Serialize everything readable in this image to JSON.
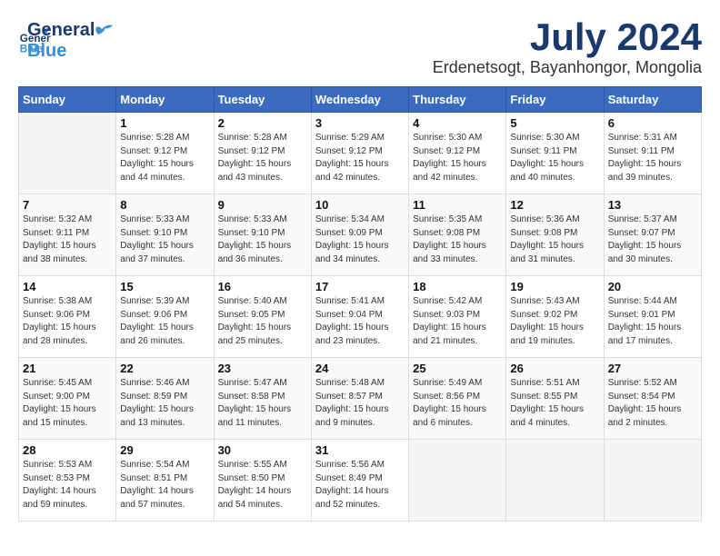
{
  "header": {
    "logo_general": "General",
    "logo_blue": "Blue",
    "month": "July 2024",
    "location": "Erdenetsogt, Bayanhongor, Mongolia"
  },
  "days_of_week": [
    "Sunday",
    "Monday",
    "Tuesday",
    "Wednesday",
    "Thursday",
    "Friday",
    "Saturday"
  ],
  "weeks": [
    [
      {
        "day": "",
        "info": ""
      },
      {
        "day": "1",
        "info": "Sunrise: 5:28 AM\nSunset: 9:12 PM\nDaylight: 15 hours\nand 44 minutes."
      },
      {
        "day": "2",
        "info": "Sunrise: 5:28 AM\nSunset: 9:12 PM\nDaylight: 15 hours\nand 43 minutes."
      },
      {
        "day": "3",
        "info": "Sunrise: 5:29 AM\nSunset: 9:12 PM\nDaylight: 15 hours\nand 42 minutes."
      },
      {
        "day": "4",
        "info": "Sunrise: 5:30 AM\nSunset: 9:12 PM\nDaylight: 15 hours\nand 42 minutes."
      },
      {
        "day": "5",
        "info": "Sunrise: 5:30 AM\nSunset: 9:11 PM\nDaylight: 15 hours\nand 40 minutes."
      },
      {
        "day": "6",
        "info": "Sunrise: 5:31 AM\nSunset: 9:11 PM\nDaylight: 15 hours\nand 39 minutes."
      }
    ],
    [
      {
        "day": "7",
        "info": "Sunrise: 5:32 AM\nSunset: 9:11 PM\nDaylight: 15 hours\nand 38 minutes."
      },
      {
        "day": "8",
        "info": "Sunrise: 5:33 AM\nSunset: 9:10 PM\nDaylight: 15 hours\nand 37 minutes."
      },
      {
        "day": "9",
        "info": "Sunrise: 5:33 AM\nSunset: 9:10 PM\nDaylight: 15 hours\nand 36 minutes."
      },
      {
        "day": "10",
        "info": "Sunrise: 5:34 AM\nSunset: 9:09 PM\nDaylight: 15 hours\nand 34 minutes."
      },
      {
        "day": "11",
        "info": "Sunrise: 5:35 AM\nSunset: 9:08 PM\nDaylight: 15 hours\nand 33 minutes."
      },
      {
        "day": "12",
        "info": "Sunrise: 5:36 AM\nSunset: 9:08 PM\nDaylight: 15 hours\nand 31 minutes."
      },
      {
        "day": "13",
        "info": "Sunrise: 5:37 AM\nSunset: 9:07 PM\nDaylight: 15 hours\nand 30 minutes."
      }
    ],
    [
      {
        "day": "14",
        "info": "Sunrise: 5:38 AM\nSunset: 9:06 PM\nDaylight: 15 hours\nand 28 minutes."
      },
      {
        "day": "15",
        "info": "Sunrise: 5:39 AM\nSunset: 9:06 PM\nDaylight: 15 hours\nand 26 minutes."
      },
      {
        "day": "16",
        "info": "Sunrise: 5:40 AM\nSunset: 9:05 PM\nDaylight: 15 hours\nand 25 minutes."
      },
      {
        "day": "17",
        "info": "Sunrise: 5:41 AM\nSunset: 9:04 PM\nDaylight: 15 hours\nand 23 minutes."
      },
      {
        "day": "18",
        "info": "Sunrise: 5:42 AM\nSunset: 9:03 PM\nDaylight: 15 hours\nand 21 minutes."
      },
      {
        "day": "19",
        "info": "Sunrise: 5:43 AM\nSunset: 9:02 PM\nDaylight: 15 hours\nand 19 minutes."
      },
      {
        "day": "20",
        "info": "Sunrise: 5:44 AM\nSunset: 9:01 PM\nDaylight: 15 hours\nand 17 minutes."
      }
    ],
    [
      {
        "day": "21",
        "info": "Sunrise: 5:45 AM\nSunset: 9:00 PM\nDaylight: 15 hours\nand 15 minutes."
      },
      {
        "day": "22",
        "info": "Sunrise: 5:46 AM\nSunset: 8:59 PM\nDaylight: 15 hours\nand 13 minutes."
      },
      {
        "day": "23",
        "info": "Sunrise: 5:47 AM\nSunset: 8:58 PM\nDaylight: 15 hours\nand 11 minutes."
      },
      {
        "day": "24",
        "info": "Sunrise: 5:48 AM\nSunset: 8:57 PM\nDaylight: 15 hours\nand 9 minutes."
      },
      {
        "day": "25",
        "info": "Sunrise: 5:49 AM\nSunset: 8:56 PM\nDaylight: 15 hours\nand 6 minutes."
      },
      {
        "day": "26",
        "info": "Sunrise: 5:51 AM\nSunset: 8:55 PM\nDaylight: 15 hours\nand 4 minutes."
      },
      {
        "day": "27",
        "info": "Sunrise: 5:52 AM\nSunset: 8:54 PM\nDaylight: 15 hours\nand 2 minutes."
      }
    ],
    [
      {
        "day": "28",
        "info": "Sunrise: 5:53 AM\nSunset: 8:53 PM\nDaylight: 14 hours\nand 59 minutes."
      },
      {
        "day": "29",
        "info": "Sunrise: 5:54 AM\nSunset: 8:51 PM\nDaylight: 14 hours\nand 57 minutes."
      },
      {
        "day": "30",
        "info": "Sunrise: 5:55 AM\nSunset: 8:50 PM\nDaylight: 14 hours\nand 54 minutes."
      },
      {
        "day": "31",
        "info": "Sunrise: 5:56 AM\nSunset: 8:49 PM\nDaylight: 14 hours\nand 52 minutes."
      },
      {
        "day": "",
        "info": ""
      },
      {
        "day": "",
        "info": ""
      },
      {
        "day": "",
        "info": ""
      }
    ]
  ]
}
